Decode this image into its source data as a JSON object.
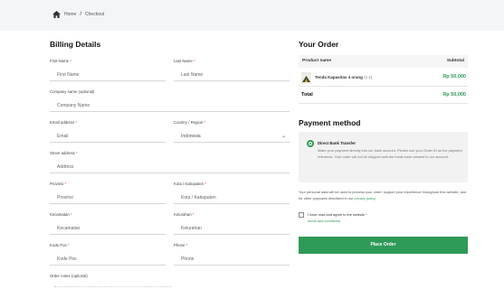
{
  "breadcrumb": {
    "home": "Home",
    "separator": "/",
    "current": "Checkout"
  },
  "billing": {
    "title": "Billing Details",
    "first_name": {
      "label": "First Name",
      "placeholder": "First Name"
    },
    "last_name": {
      "label": "Last Name",
      "placeholder": "Last Name"
    },
    "company": {
      "label": "Company name (optional)",
      "placeholder": "Company Name"
    },
    "email": {
      "label": "Email address",
      "placeholder": "Email"
    },
    "country": {
      "label": "Country / Region",
      "value": "Indonesia"
    },
    "street": {
      "label": "Street address",
      "placeholder": "Address"
    },
    "province": {
      "label": "Provinsi",
      "placeholder": "Provinsi"
    },
    "city": {
      "label": "Kota / Kabupaten",
      "placeholder": "Kota / Kabupaten"
    },
    "district": {
      "label": "Kecamatan",
      "placeholder": "Kecamatan"
    },
    "village": {
      "label": "Kelurahan",
      "placeholder": "Kelurahan"
    },
    "postcode": {
      "label": "Kode Pos",
      "placeholder": "Kode Pos"
    },
    "phone": {
      "label": "Phone",
      "placeholder": "Phone"
    },
    "order_notes": {
      "label": "Order notes (optional)"
    },
    "required_mark": "*"
  },
  "order": {
    "title": "Your Order",
    "col_product": "Product name",
    "col_subtotal": "Subtotal",
    "items": [
      {
        "name": "Tenda Kapasitas 4 orang",
        "qty": "(x 1)",
        "price": "Rp 50,000"
      }
    ],
    "total_label": "Total",
    "total_value": "Rp 50,000"
  },
  "payment": {
    "title": "Payment method",
    "method": "Direct Bank Transfer",
    "description": "Make your payment directly into our bank account. Please use your Order ID as the payment reference. Your order will not be shipped until the funds have cleared in our account.",
    "privacy_text": "Your personal data will be used to process your order, support your experience throughout this website, and for other purposes described in our",
    "privacy_link": "privacy policy.",
    "terms_text": "I have read and agree to the website",
    "terms_link": "terms and conditions",
    "place_order": "Place Order"
  },
  "colors": {
    "accent": "#2e9a58",
    "required": "#e53935"
  }
}
